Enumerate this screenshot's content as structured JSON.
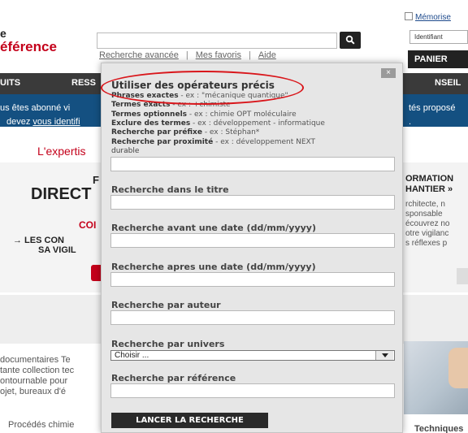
{
  "logo": {
    "line1": "e",
    "line2": "éférence"
  },
  "search": {
    "value": "",
    "button_icon": "search-icon"
  },
  "top_links": [
    "Recherche avancée",
    "Mes favoris",
    "Aide"
  ],
  "account": {
    "remember_label": "Mémorise",
    "identifiant_placeholder": "Identifiant",
    "cart_label": "PANIER"
  },
  "nav": {
    "left": "UITS",
    "middle": "RESS",
    "right": "NSEIL"
  },
  "banner": {
    "line1_left": "us êtes abonné vi",
    "line1_right": "tés proposé",
    "line2_prefix": "devez ",
    "line2_link": "vous identifi",
    "line2_right": "."
  },
  "background": {
    "expertise": "L'expertis",
    "promo_left": [
      "F",
      "DIRECT",
      "COI",
      "→ LES CON",
      "SA VIGIL"
    ],
    "promo_right": [
      "ORMATION",
      "HANTIER »",
      "rchitecte, n",
      "sponsable",
      "écouvrez no",
      "otre vigilanc",
      "s réflexes p"
    ],
    "body_lines": [
      " documentaires Te",
      "tante collection tec",
      "ontournable  pour",
      "ojet,  bureaux  d'é"
    ],
    "footer_left": "Procédés chimie",
    "footer_right": "Techniques"
  },
  "panel": {
    "close_label": "×",
    "operators_title": "Utiliser des opérateurs précis",
    "operators": [
      {
        "name": "Phrases exactes",
        "example": " - ex : \"mécanique quantique\""
      },
      {
        "name": "Termes exacts",
        "example": " - ex : +chimiste"
      },
      {
        "name": "Termes optionnels",
        "example": " - ex : chimie OPT moléculaire"
      },
      {
        "name": "Exclure des termes",
        "example": " - ex : développement - informatique"
      },
      {
        "name": "Recherche par préfixe",
        "example": " - ex : Stéphan*"
      },
      {
        "name": "Recherche par proximité",
        "example": " - ex : développement NEXT"
      }
    ],
    "operators_tail": "durable",
    "fields": {
      "title_label": "Recherche dans le titre",
      "before_label": "Recherche avant une date (dd/mm/yyyy)",
      "after_label": "Recherche apres une date (dd/mm/yyyy)",
      "author_label": "Recherche par auteur",
      "universe_label": "Recherche par univers",
      "universe_selected": "Choisir ...",
      "reference_label": "Recherche par référence"
    },
    "launch_label": "LANCER LA RECHERCHE"
  },
  "colors": {
    "brand_red": "#c4001a",
    "banner_blue": "#145081",
    "nav_dark": "#3a3a3a",
    "annotation_red": "#d9161b"
  }
}
